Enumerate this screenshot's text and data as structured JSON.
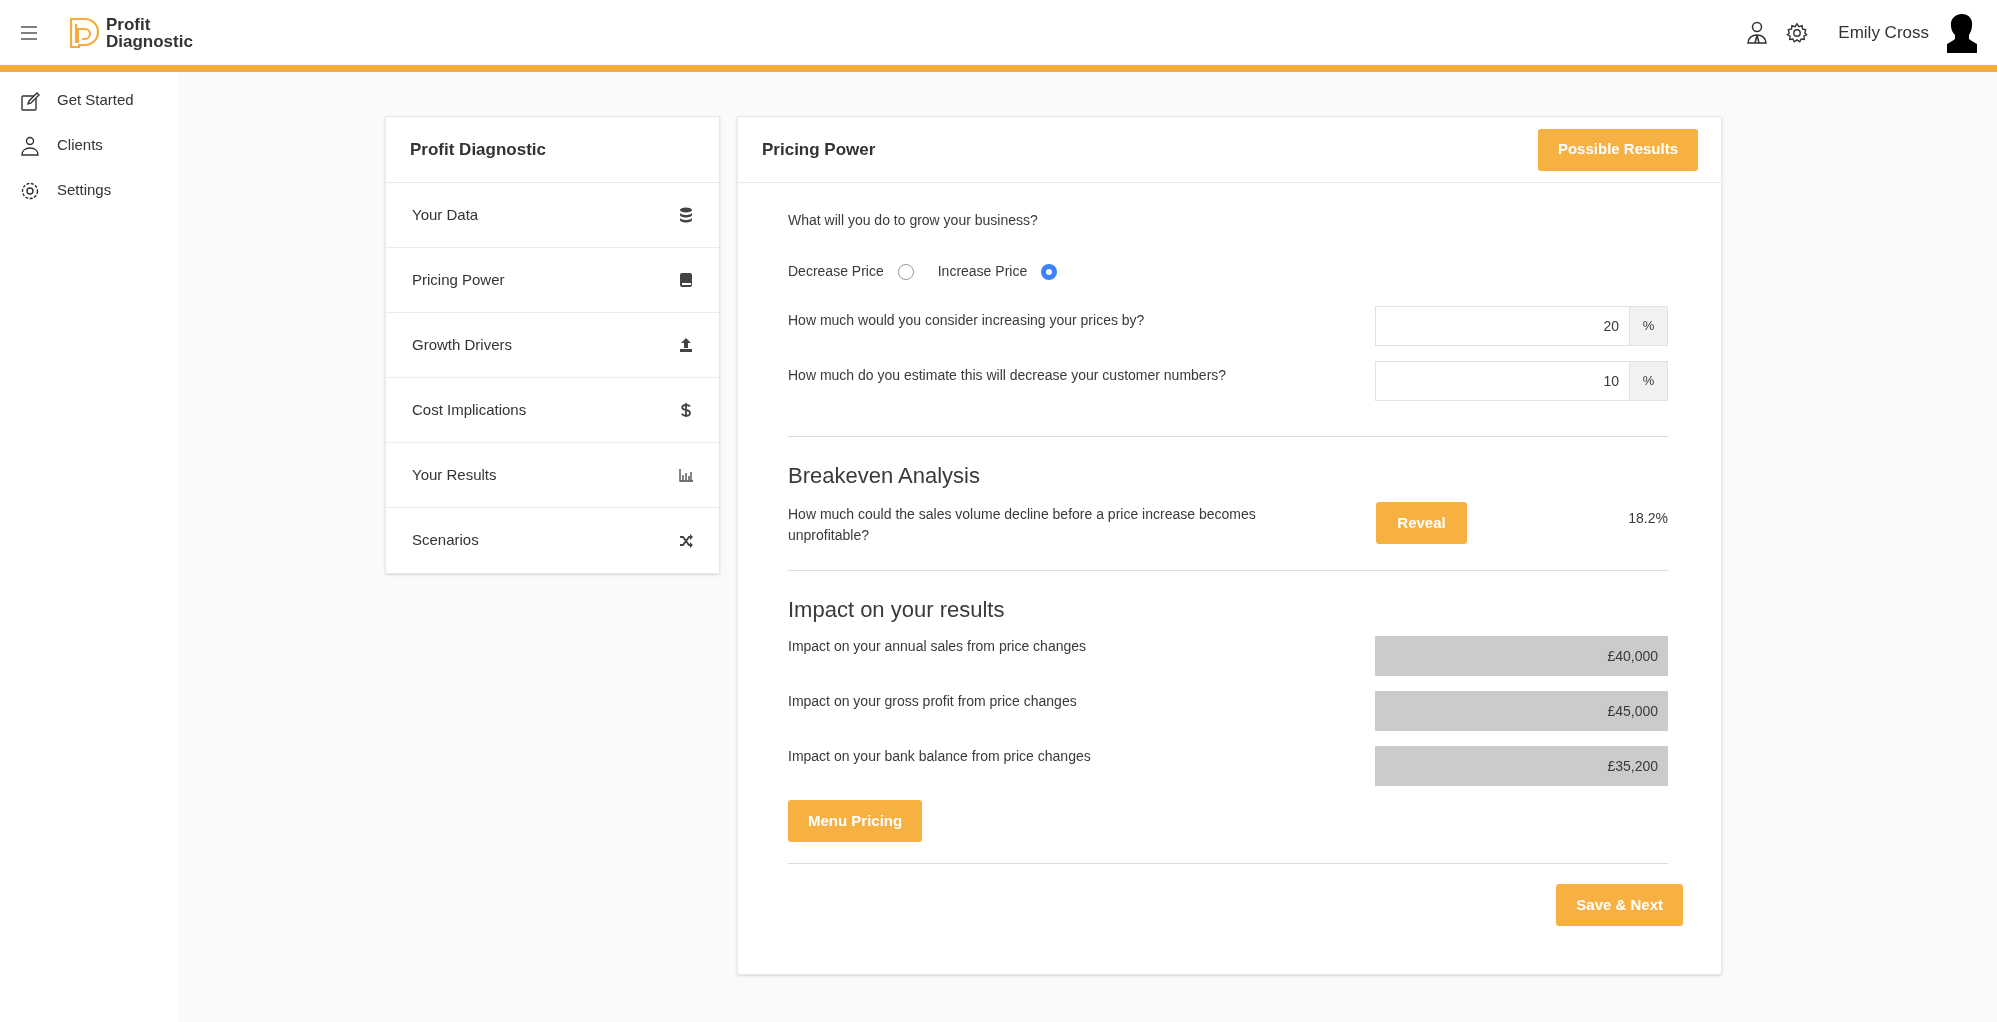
{
  "header": {
    "brand_line_1": "Profit",
    "brand_line_2": "Diagnostic",
    "user_name": "Emily Cross"
  },
  "sidebar": {
    "items": [
      {
        "label": "Get Started"
      },
      {
        "label": "Clients"
      },
      {
        "label": "Settings"
      }
    ]
  },
  "steps_panel": {
    "title": "Profit Diagnostic",
    "items": [
      {
        "label": "Your Data"
      },
      {
        "label": "Pricing Power"
      },
      {
        "label": "Growth Drivers"
      },
      {
        "label": "Cost Implications"
      },
      {
        "label": "Your Results"
      },
      {
        "label": "Scenarios"
      }
    ]
  },
  "main": {
    "title": "Pricing Power",
    "header_button": "Possible Results",
    "question": "What will you do to grow your business?",
    "options": [
      {
        "label": "Decrease Price",
        "selected": false
      },
      {
        "label": "Increase Price",
        "selected": true
      }
    ],
    "inputs": [
      {
        "label": "How much would you consider increasing your prices by?",
        "value": "20",
        "unit": "%"
      },
      {
        "label": "How much do you estimate this will decrease your customer numbers?",
        "value": "10",
        "unit": "%"
      }
    ],
    "breakeven": {
      "title": "Breakeven Analysis",
      "question": "How much could the sales volume decline before a price increase becomes unprofitable?",
      "button": "Reveal",
      "result": "18.2%"
    },
    "impact": {
      "title": "Impact on your results",
      "rows": [
        {
          "label": "Impact on your annual sales from price changes",
          "value": "£40,000"
        },
        {
          "label": "Impact on your gross profit from price changes",
          "value": "£45,000"
        },
        {
          "label": "Impact on your bank balance from price changes",
          "value": "£35,200"
        }
      ]
    },
    "menu_button": "Menu Pricing",
    "save_button": "Save & Next"
  }
}
